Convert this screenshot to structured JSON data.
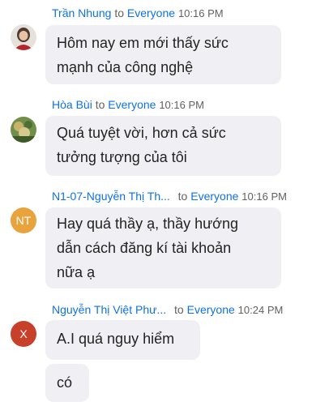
{
  "messages": [
    {
      "sender": "Trần Nhung",
      "to": "to",
      "recipient": "Everyone",
      "time": "10:16 PM",
      "avatar_icon": "photo-avatar",
      "bubbles": [
        {
          "lines": [
            "Hôm nay em mới thấy sức",
            "mạnh của công nghệ"
          ]
        }
      ]
    },
    {
      "sender": "Hòa Bùi",
      "to": "to",
      "recipient": "Everyone",
      "time": "10:16 PM",
      "avatar_icon": "photo-avatar",
      "bubbles": [
        {
          "lines": [
            "Quá tuyệt vời, hơn cả sức",
            "tưởng tượng của tôi"
          ]
        }
      ]
    },
    {
      "sender": "N1-07-Nguyễn Thị Th...",
      "to": "to",
      "recipient": "Everyone",
      "time": "10:16 PM",
      "avatar_initials": "NT",
      "avatar_color": "#e8a33c",
      "bubbles": [
        {
          "lines": [
            "Hay quá thầy ạ, thầy hướng",
            "dẫn cách đăng kí tài khoản",
            "nữa ạ"
          ]
        }
      ]
    },
    {
      "sender": "Nguyễn Thị Việt Phư...",
      "to": "to",
      "recipient": "Everyone",
      "time": "10:24 PM",
      "avatar_initials": "X",
      "avatar_color": "#c6402a",
      "bubbles": [
        {
          "lines": [
            "A.I quá nguy hiểm"
          ]
        },
        {
          "lines": [
            "có"
          ]
        }
      ]
    }
  ]
}
